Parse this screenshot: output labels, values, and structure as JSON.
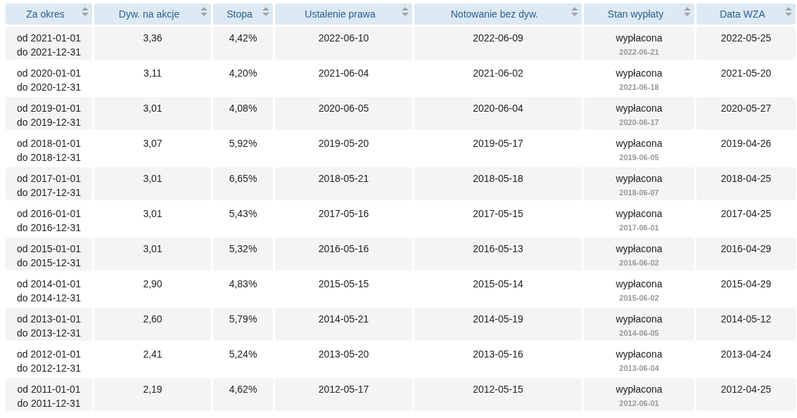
{
  "table": {
    "columns": [
      "Za okres",
      "Dyw. na akcje",
      "Stopa",
      "Ustalenie prawa",
      "Notowanie bez dyw.",
      "Stan wypłaty",
      "Data WZA"
    ],
    "rows": [
      {
        "period_from": "od 2021-01-01",
        "period_to": "do 2021-12-31",
        "dividend": "3,36",
        "rate": "4,42%",
        "record_date": "2022-06-10",
        "ex_date": "2022-06-09",
        "status": "wypłacona",
        "paid_date": "2022-06-21",
        "agm_date": "2022-05-25"
      },
      {
        "period_from": "od 2020-01-01",
        "period_to": "do 2020-12-31",
        "dividend": "3,11",
        "rate": "4,20%",
        "record_date": "2021-06-04",
        "ex_date": "2021-06-02",
        "status": "wypłacona",
        "paid_date": "2021-06-18",
        "agm_date": "2021-05-20"
      },
      {
        "period_from": "od 2019-01-01",
        "period_to": "do 2019-12-31",
        "dividend": "3,01",
        "rate": "4,08%",
        "record_date": "2020-06-05",
        "ex_date": "2020-06-04",
        "status": "wypłacona",
        "paid_date": "2020-06-17",
        "agm_date": "2020-05-27"
      },
      {
        "period_from": "od 2018-01-01",
        "period_to": "do 2018-12-31",
        "dividend": "3,07",
        "rate": "5,92%",
        "record_date": "2019-05-20",
        "ex_date": "2019-05-17",
        "status": "wypłacona",
        "paid_date": "2019-06-05",
        "agm_date": "2019-04-26"
      },
      {
        "period_from": "od 2017-01-01",
        "period_to": "do 2017-12-31",
        "dividend": "3,01",
        "rate": "6,65%",
        "record_date": "2018-05-21",
        "ex_date": "2018-05-18",
        "status": "wypłacona",
        "paid_date": "2018-06-07",
        "agm_date": "2018-04-25"
      },
      {
        "period_from": "od 2016-01-01",
        "period_to": "do 2016-12-31",
        "dividend": "3,01",
        "rate": "5,43%",
        "record_date": "2017-05-16",
        "ex_date": "2017-05-15",
        "status": "wypłacona",
        "paid_date": "2017-06-01",
        "agm_date": "2017-04-25"
      },
      {
        "period_from": "od 2015-01-01",
        "period_to": "do 2015-12-31",
        "dividend": "3,01",
        "rate": "5,32%",
        "record_date": "2016-05-16",
        "ex_date": "2016-05-13",
        "status": "wypłacona",
        "paid_date": "2016-06-02",
        "agm_date": "2016-04-29"
      },
      {
        "period_from": "od 2014-01-01",
        "period_to": "do 2014-12-31",
        "dividend": "2,90",
        "rate": "4,83%",
        "record_date": "2015-05-15",
        "ex_date": "2015-05-14",
        "status": "wypłacona",
        "paid_date": "2015-06-02",
        "agm_date": "2015-04-29"
      },
      {
        "period_from": "od 2013-01-01",
        "period_to": "do 2013-12-31",
        "dividend": "2,60",
        "rate": "5,79%",
        "record_date": "2014-05-21",
        "ex_date": "2014-05-19",
        "status": "wypłacona",
        "paid_date": "2014-06-05",
        "agm_date": "2014-05-12"
      },
      {
        "period_from": "od 2012-01-01",
        "period_to": "do 2012-12-31",
        "dividend": "2,41",
        "rate": "5,24%",
        "record_date": "2013-05-20",
        "ex_date": "2013-05-16",
        "status": "wypłacona",
        "paid_date": "2013-06-04",
        "agm_date": "2013-04-24"
      },
      {
        "period_from": "od 2011-01-01",
        "period_to": "do 2011-12-31",
        "dividend": "2,19",
        "rate": "4,62%",
        "record_date": "2012-05-17",
        "ex_date": "2012-05-15",
        "status": "wypłacona",
        "paid_date": "2012-06-01",
        "agm_date": "2012-04-25"
      }
    ]
  }
}
